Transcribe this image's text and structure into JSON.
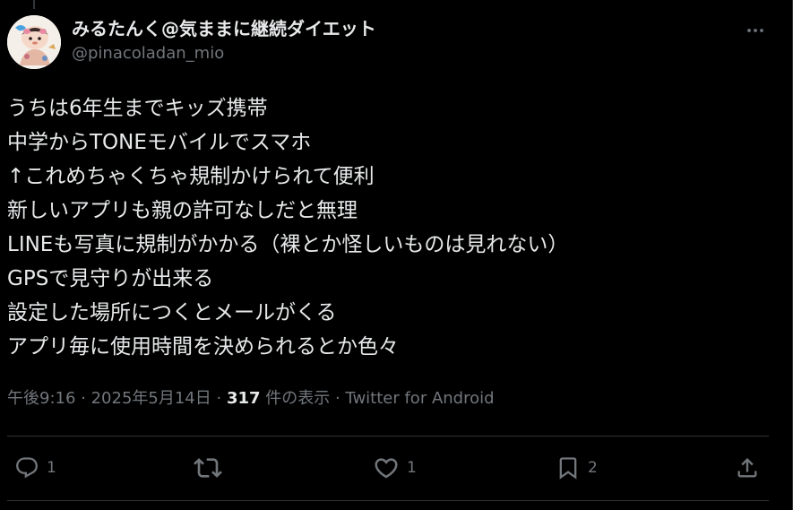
{
  "author": {
    "display_name": "みるたんく@気ままに継続ダイエット",
    "handle": "@pinacoladan_mio"
  },
  "tweet": {
    "lines": [
      "うちは6年生までキッズ携帯",
      "中学からTONEモバイルでスマホ",
      "↑これめちゃくちゃ規制かけられて便利",
      "新しいアプリも親の許可なしだと無理",
      "LINEも写真に規制がかかる（裸とか怪しいものは見れない）",
      "GPSで見守りが出来る",
      "設定した場所につくとメールがくる",
      "アプリ毎に使用時間を決められるとか色々"
    ]
  },
  "meta": {
    "time": "午後9:16",
    "sep1": " · ",
    "date": "2025年5月14日",
    "sep2": " · ",
    "views_count": "317",
    "views_label": " 件の表示",
    "sep3": " · ",
    "source": "Twitter for Android"
  },
  "actions": {
    "reply_count": "1",
    "like_count": "1",
    "bookmark_count": "2"
  },
  "icons": {
    "more": "more-horizontal-icon",
    "reply": "reply-icon",
    "retweet": "retweet-icon",
    "like": "heart-icon",
    "bookmark": "bookmark-icon",
    "share": "share-icon"
  },
  "colors": {
    "background": "#000000",
    "text_primary": "#e7e9ea",
    "text_secondary": "#71767b",
    "border": "#2f3336"
  }
}
